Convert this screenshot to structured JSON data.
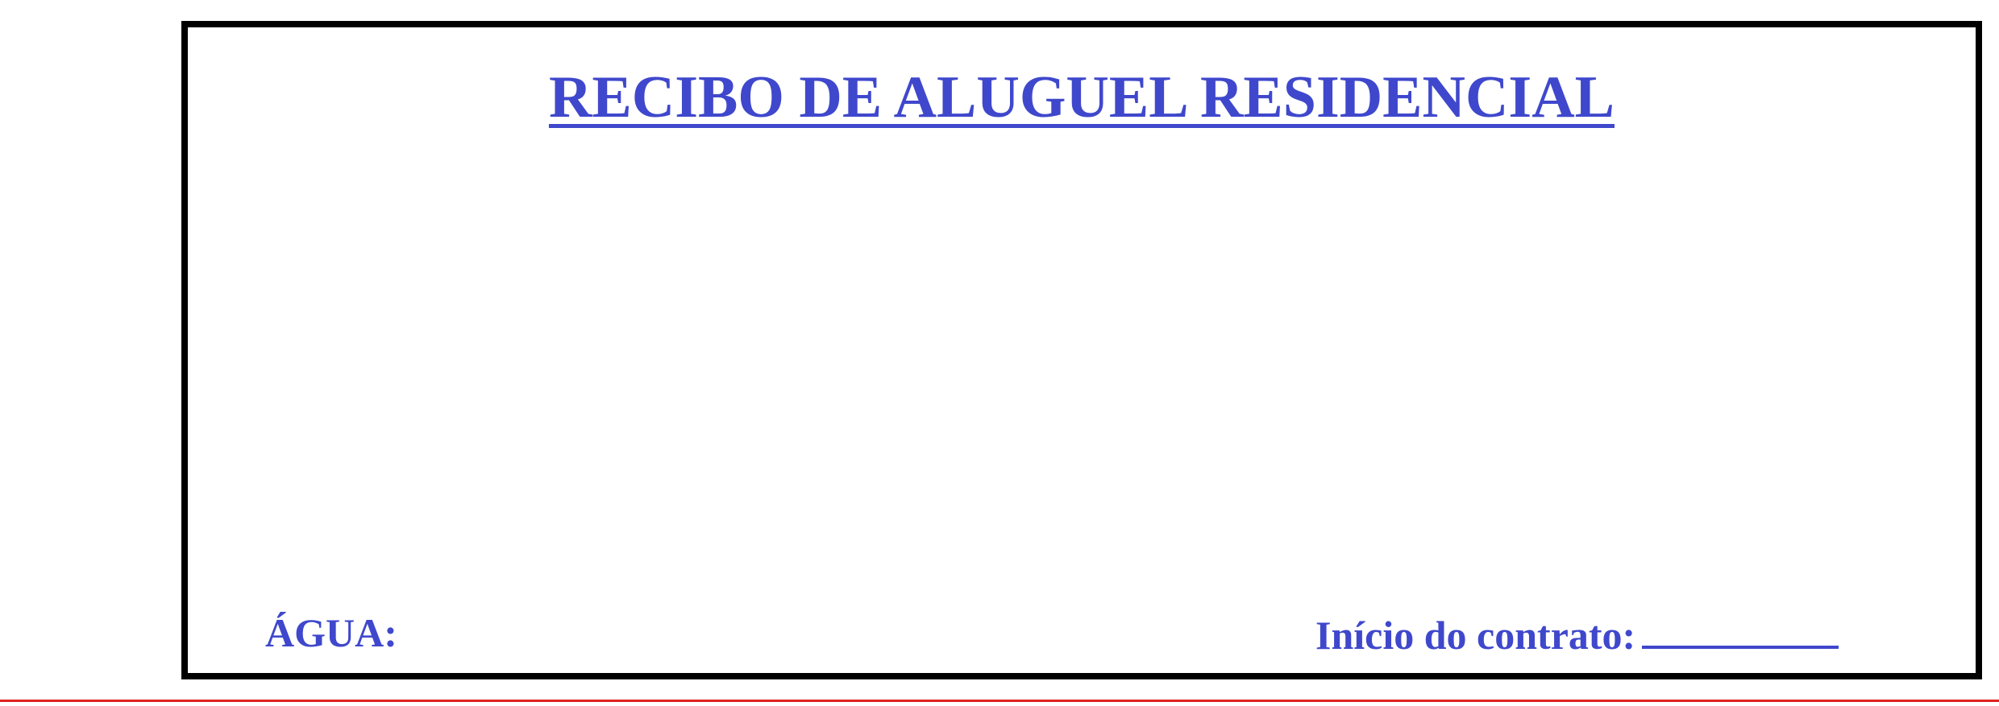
{
  "receipt": {
    "title": "RECIBO DE ALUGUEL RESIDENCIAL",
    "water_label": "ÁGUA:",
    "contract_start_label": "Início do contrato:"
  },
  "colors": {
    "text": "#3f48cc",
    "frame": "#000000",
    "bottom_rule": "#e02020"
  }
}
